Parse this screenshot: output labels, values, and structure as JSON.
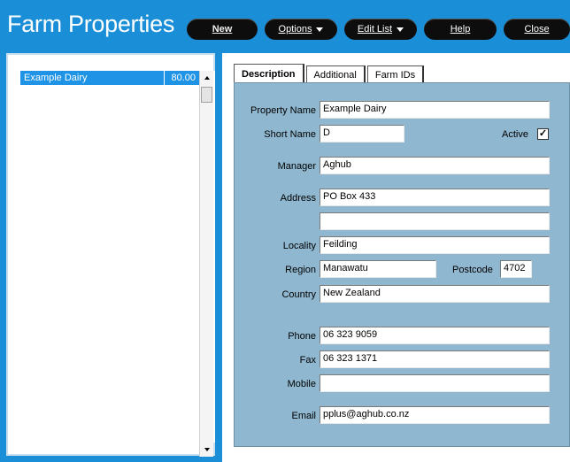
{
  "app": {
    "title": "Farm Properties"
  },
  "toolbar": {
    "new_label": "New",
    "options_label": "Options",
    "edit_list_label": "Edit List",
    "help_label": "Help",
    "close_label": "Close"
  },
  "list": {
    "items": [
      {
        "name": "Example Dairy",
        "value": "80.00"
      }
    ]
  },
  "tabs": [
    {
      "label": "Description"
    },
    {
      "label": "Additional"
    },
    {
      "label": "Farm IDs"
    }
  ],
  "form": {
    "property_name_label": "Property Name",
    "property_name": "Example Dairy",
    "short_name_label": "Short Name",
    "short_name": "D",
    "active_label": "Active",
    "active_checked": true,
    "manager_label": "Manager",
    "manager": "Aghub",
    "address_label": "Address",
    "address_line1": "PO Box 433",
    "address_line2": "",
    "locality_label": "Locality",
    "locality": "Feilding",
    "region_label": "Region",
    "region": "Manawatu",
    "postcode_label": "Postcode",
    "postcode": "4702",
    "country_label": "Country",
    "country": "New Zealand",
    "phone_label": "Phone",
    "phone": "06 323 9059",
    "fax_label": "Fax",
    "fax": "06 323 1371",
    "mobile_label": "Mobile",
    "mobile": "",
    "email_label": "Email",
    "email": "pplus@aghub.co.nz"
  },
  "colors": {
    "header_bg": "#1a8fd8",
    "form_bg": "#8fb7cf",
    "selection": "#1f93e6"
  }
}
